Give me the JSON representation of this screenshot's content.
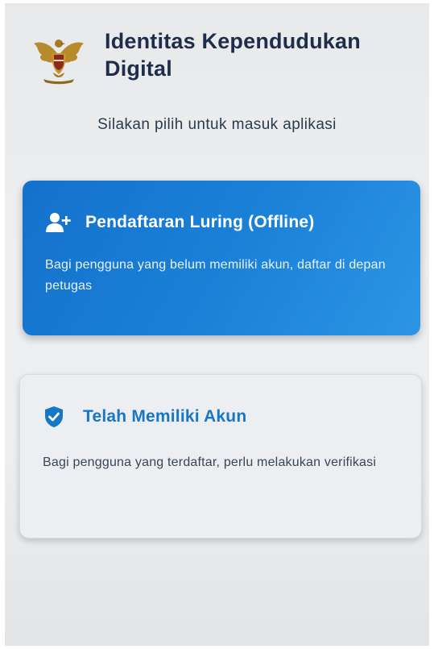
{
  "header": {
    "title": "Identitas Kependudukan Digital",
    "logo_icon": "garuda-emblem-icon"
  },
  "subtitle": "Silakan pilih untuk masuk aplikasi",
  "options": {
    "offline": {
      "icon": "add-person-icon",
      "title": "Pendaftaran Luring (Offline)",
      "description": "Bagi pengguna yang belum memiliki akun, daftar di depan petugas",
      "color": "#1877d2"
    },
    "account": {
      "icon": "shield-check-icon",
      "title": "Telah Memiliki Akun",
      "description": "Bagi pengguna yang terdaftar, perlu melakukan verifikasi",
      "color": "#1677c5"
    }
  }
}
